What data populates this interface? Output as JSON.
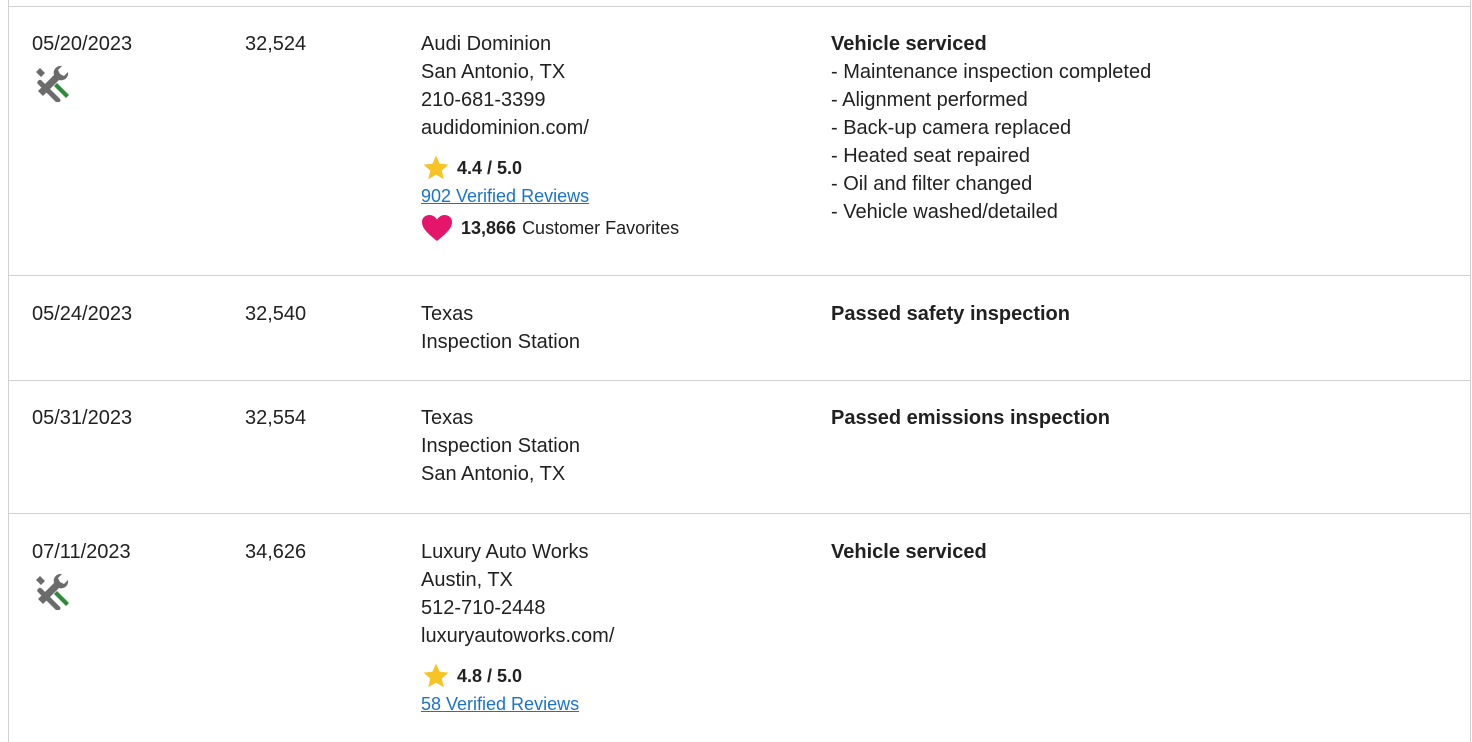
{
  "records": [
    {
      "date": "05/20/2023",
      "mileage": "32,524",
      "service_icon": "wrench-screwdriver-icon",
      "source": [
        "Audi Dominion",
        "San Antonio, TX",
        "210-681-3399",
        "audidominion.com/"
      ],
      "rating": "4.4 / 5.0",
      "reviews": "902 Verified Reviews",
      "favorites_count": "13,866",
      "favorites_label": "Customer Favorites",
      "detail_title": "Vehicle serviced",
      "details": [
        "- Maintenance inspection completed",
        "- Alignment performed",
        "- Back-up camera replaced",
        "- Heated seat repaired",
        "- Oil and filter changed",
        "- Vehicle washed/detailed"
      ]
    },
    {
      "date": "05/24/2023",
      "mileage": "32,540",
      "source": [
        "Texas",
        "Inspection Station"
      ],
      "detail_title": "Passed safety inspection"
    },
    {
      "date": "05/31/2023",
      "mileage": "32,554",
      "source": [
        "Texas",
        "Inspection Station",
        "San Antonio, TX"
      ],
      "detail_title": "Passed emissions inspection"
    },
    {
      "date": "07/11/2023",
      "mileage": "34,626",
      "service_icon": "wrench-screwdriver-icon",
      "source": [
        "Luxury Auto Works",
        "Austin, TX",
        "512-710-2448",
        "luxuryautoworks.com/"
      ],
      "rating": "4.8 / 5.0",
      "reviews": "58 Verified Reviews",
      "detail_title": "Vehicle serviced"
    }
  ],
  "colors": {
    "link": "#1a73c8",
    "star": "#f7c325",
    "heart": "#e4156a",
    "tool_green": "#2e8b3a",
    "tool_gray": "#6b6b6b",
    "divider": "#d2d2d2"
  }
}
